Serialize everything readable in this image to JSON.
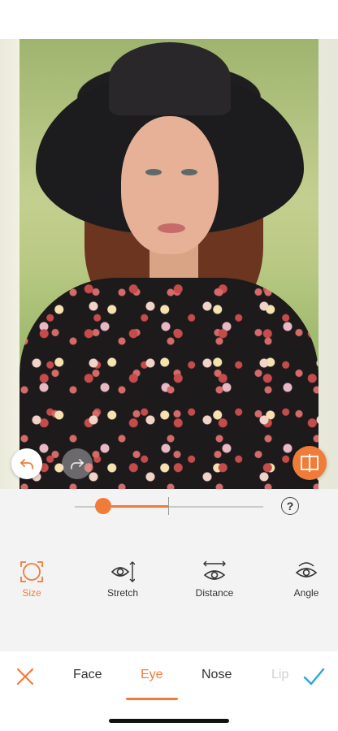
{
  "colors": {
    "accent": "#f07c3a",
    "panel": "#f3f3f3",
    "text": "#333333"
  },
  "photo": {
    "icon": "portrait-photo"
  },
  "slider": {
    "value_fraction": 0.15,
    "help_label": "?"
  },
  "tools": [
    {
      "label": "Size",
      "icon": "size-icon",
      "active": true
    },
    {
      "label": "Stretch",
      "icon": "eye-stretch-icon",
      "active": false
    },
    {
      "label": "Distance",
      "icon": "eye-distance-icon",
      "active": false
    },
    {
      "label": "Angle",
      "icon": "eye-angle-icon",
      "active": false
    }
  ],
  "tabs": [
    {
      "label": "Face",
      "active": false
    },
    {
      "label": "Eye",
      "active": true
    },
    {
      "label": "Nose",
      "active": false
    },
    {
      "label": "Lip",
      "active": false
    }
  ]
}
